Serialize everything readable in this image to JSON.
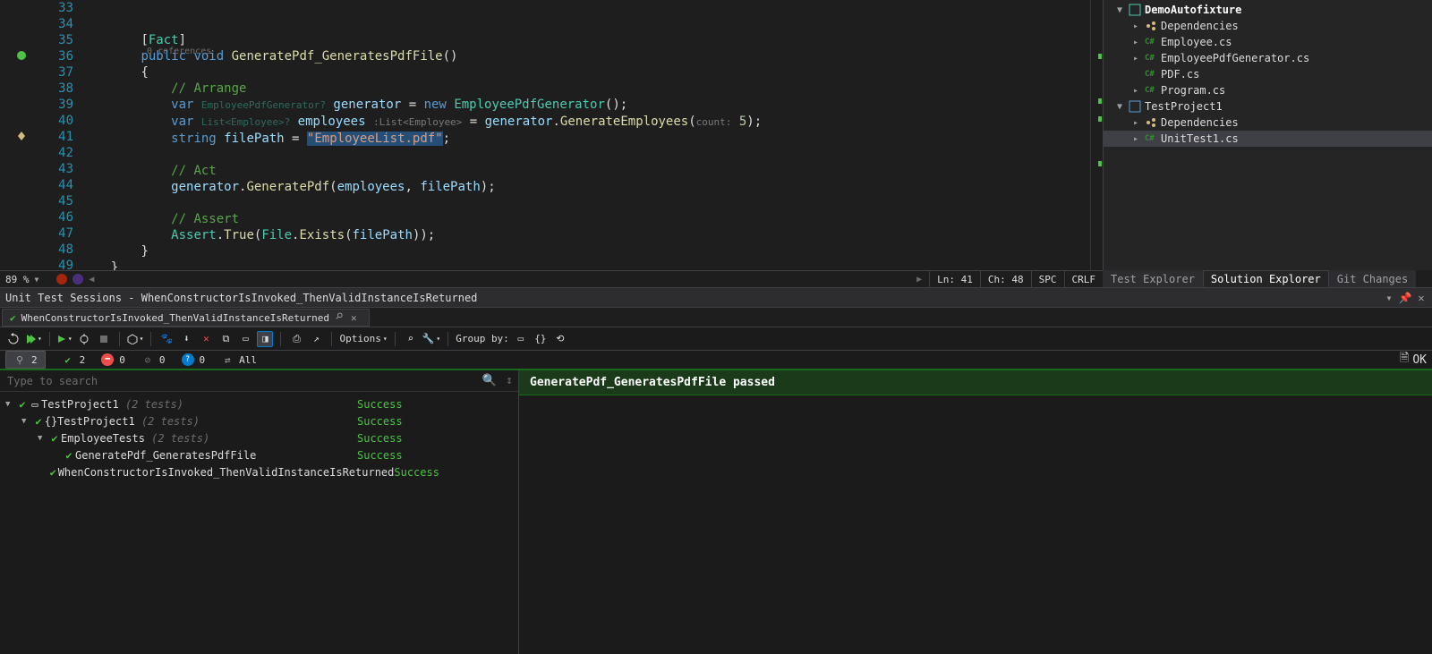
{
  "editor": {
    "zoom": "89 %",
    "line_numbers": [
      33,
      34,
      35,
      36,
      37,
      38,
      39,
      40,
      41,
      42,
      43,
      44,
      45,
      46,
      47,
      48,
      49
    ],
    "codelens": "0 references",
    "tokens": {
      "fact": "Fact",
      "public": "public",
      "void": "void",
      "method_name": "GeneratePdf_GeneratesPdfFile",
      "c_arrange": "// Arrange",
      "var": "var",
      "t_gen_hint": "EmployeePdfGenerator?",
      "generator": "generator",
      "new": "new",
      "t_gen": "EmployeePdfGenerator",
      "t_list_hint": "List<Employee>?",
      "employees": "employees",
      "list_anno": ":List<Employee>",
      "dot_gen_emp": "GenerateEmployees",
      "count_hint": "count:",
      "five": "5",
      "string": "string",
      "filePath": "filePath",
      "str_lit": "\"EmployeeList.pdf\"",
      "c_act": "// Act",
      "dot_gen_pdf": "GeneratePdf",
      "c_assert": "// Assert",
      "assert": "Assert",
      "true": "True",
      "file": "File",
      "exists": "Exists"
    },
    "status": {
      "ln": "Ln: 41",
      "ch": "Ch: 48",
      "spc": "SPC",
      "crlf": "CRLF"
    }
  },
  "solution_explorer": {
    "project": "DemoAutofixture",
    "items": [
      {
        "depth": 1,
        "chev": "▸",
        "icon": "dep",
        "label": "Dependencies"
      },
      {
        "depth": 1,
        "chev": "▸",
        "icon": "cs",
        "label": "Employee.cs"
      },
      {
        "depth": 1,
        "chev": "▸",
        "icon": "cs",
        "label": "EmployeePdfGenerator.cs"
      },
      {
        "depth": 1,
        "chev": "",
        "icon": "cs",
        "label": "PDF.cs"
      },
      {
        "depth": 1,
        "chev": "▸",
        "icon": "cs",
        "label": "Program.cs"
      }
    ],
    "test_project": "TestProject1",
    "test_items": [
      {
        "depth": 1,
        "chev": "▸",
        "icon": "dep",
        "label": "Dependencies"
      },
      {
        "depth": 1,
        "chev": "▸",
        "icon": "cs",
        "label": "UnitTest1.cs",
        "selected": true
      }
    ],
    "tabs": [
      "Test Explorer",
      "Solution Explorer",
      "Git Changes"
    ],
    "active_tab": 1
  },
  "uts": {
    "title": "Unit Test Sessions - WhenConstructorIsInvoked_ThenValidInstanceIsReturned",
    "tab_label": "WhenConstructorIsInvoked_ThenValidInstanceIsReturned",
    "options_label": "Options",
    "groupby_label": "Group by:",
    "filters": [
      {
        "icon": "pin",
        "count": "2",
        "active": true
      },
      {
        "icon": "ok",
        "count": "2"
      },
      {
        "icon": "fail",
        "count": "0"
      },
      {
        "icon": "ignored",
        "count": "0"
      },
      {
        "icon": "unknown",
        "count": "0"
      },
      {
        "icon": "all",
        "label": "All"
      }
    ],
    "ok_label": "OK",
    "search_placeholder": "Type to search",
    "tree": [
      {
        "depth": 0,
        "chev": "▼",
        "icon": "ok-sq",
        "name": "TestProject1",
        "suffix": "(2 tests)",
        "result": "Success"
      },
      {
        "depth": 1,
        "chev": "▼",
        "icon": "ns",
        "name": "TestProject1",
        "suffix": "(2 tests)",
        "result": "Success"
      },
      {
        "depth": 2,
        "chev": "▼",
        "icon": "ok",
        "name": "EmployeeTests",
        "suffix": "(2 tests)",
        "result": "Success"
      },
      {
        "depth": 3,
        "chev": "",
        "icon": "ok",
        "name": "GeneratePdf_GeneratesPdfFile",
        "suffix": "",
        "result": "Success"
      },
      {
        "depth": 3,
        "chev": "",
        "icon": "ok",
        "name": "WhenConstructorIsInvoked_ThenValidInstanceIsReturned",
        "suffix": "",
        "result": "Success"
      }
    ],
    "detail_header": "GeneratePdf_GeneratesPdfFile passed"
  }
}
